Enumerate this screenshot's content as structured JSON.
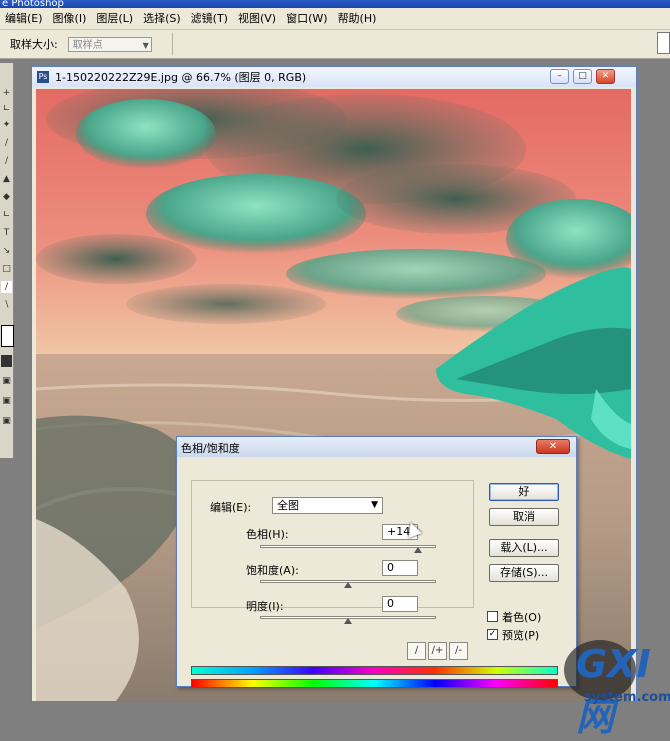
{
  "app": {
    "title": "e Photoshop",
    "menu": [
      "编辑(E)",
      "图像(I)",
      "图层(L)",
      "选择(S)",
      "滤镜(T)",
      "视图(V)",
      "窗口(W)",
      "帮助(H)"
    ],
    "options": {
      "sample_label": "取样大小:",
      "sample_value": "取样点"
    }
  },
  "document": {
    "title": "1-150220222Z29E.jpg @ 66.7% (图层 0, RGB)",
    "buttons": {
      "minimize": "–",
      "maximize": "□",
      "close": "✕"
    }
  },
  "dialog": {
    "title": "色相/饱和度",
    "close": "✕",
    "edit_label": "编辑(E):",
    "edit_value": "全图",
    "hue": {
      "label": "色相(H):",
      "value": "+143",
      "level": 143,
      "min": -180,
      "max": 180
    },
    "saturation": {
      "label": "饱和度(A):",
      "value": "0",
      "level": 0,
      "min": -100,
      "max": 100
    },
    "lightness": {
      "label": "明度(I):",
      "value": "0",
      "level": 0,
      "min": -100,
      "max": 100
    },
    "buttons": {
      "ok": "好",
      "cancel": "取消",
      "load": "载入(L)...",
      "save": "存储(S)..."
    },
    "colorize": {
      "label": "着色(O)",
      "checked": false
    },
    "preview": {
      "label": "预览(P)",
      "checked": true
    }
  },
  "watermark": {
    "logo": "GXI网",
    "domain": "system.com"
  },
  "colors": {
    "sky": "#e7746a",
    "cloud": "#5fbfa2",
    "rock": "#2fc4a8",
    "sea": "#b39c86",
    "titlebar": "#1b46a9"
  },
  "icons": [
    "eyedropper-icon",
    "eyedropper-plus-icon",
    "eyedropper-minus-icon",
    "photoshop-doc-icon",
    "dropdown-arrow-icon"
  ]
}
